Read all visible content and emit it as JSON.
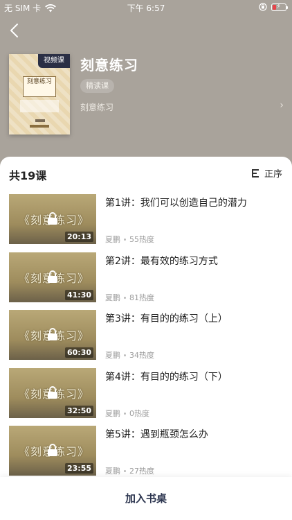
{
  "status_bar": {
    "carrier": "无 SIM 卡",
    "time": "下午 6:57",
    "wifi_icon": "wifi-icon",
    "orientation_icon": "orientation-lock-icon",
    "battery_color": "#e8444a"
  },
  "header": {
    "back_icon": "chevron-left-icon",
    "cover_badge": "视频课",
    "cover_title": "刻意练习",
    "course_title": "刻意练习",
    "tag": "精读课",
    "link_text": "刻意练习",
    "link_chevron_icon": "chevron-right-icon"
  },
  "sheet": {
    "count": "共19课",
    "sort_label": "正序",
    "sort_icon": "sort-icon"
  },
  "lessons": [
    {
      "title": "第1讲：我们可以创造自己的潜力",
      "thumb_text": "《刻意练习》",
      "duration": "20:13",
      "author": "夏鹏",
      "heat": "55热度"
    },
    {
      "title": "第2讲：最有效的练习方式",
      "thumb_text": "《刻意练习》",
      "duration": "41:30",
      "author": "夏鹏",
      "heat": "81热度"
    },
    {
      "title": "第3讲：有目的的练习（上）",
      "thumb_text": "《刻意练习》",
      "duration": "60:30",
      "author": "夏鹏",
      "heat": "34热度"
    },
    {
      "title": "第4讲：有目的的练习（下）",
      "thumb_text": "《刻意练习》",
      "duration": "32:50",
      "author": "夏鹏",
      "heat": "0热度"
    },
    {
      "title": "第5讲：遇到瓶颈怎么办",
      "thumb_text": "《刻意练习》",
      "duration": "23:55",
      "author": "夏鹏",
      "heat": "27热度"
    }
  ],
  "bottom": {
    "add_button": "加入书桌"
  },
  "colors": {
    "header_bg": "#a9a39b",
    "badge_bg": "#2b2f45",
    "button_text": "#2d3650"
  }
}
